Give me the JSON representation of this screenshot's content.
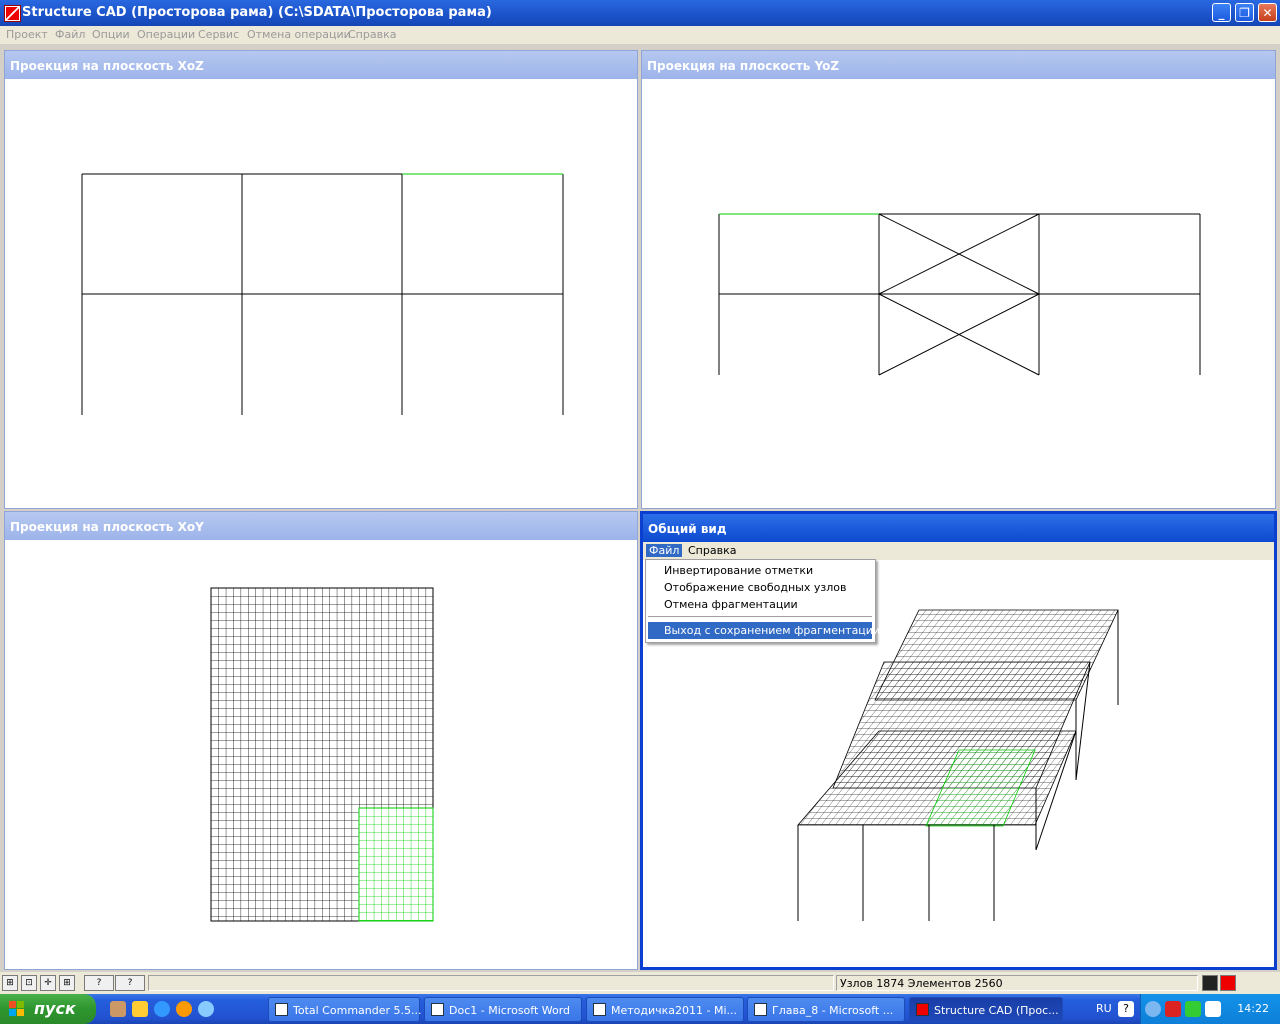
{
  "window": {
    "title": "Structure CAD (Просторова рама) (C:\\SDATA\\Просторова рама)",
    "controls": [
      "minimize",
      "restore",
      "close"
    ]
  },
  "menu": [
    "Проект",
    "Файл",
    "Опции",
    "Операции",
    "Сервис",
    "Отмена операции",
    "Справка"
  ],
  "panels": {
    "xoz": {
      "title": "Проекция на плоскость XoZ"
    },
    "yoz": {
      "title": "Проекция на плоскость YoZ"
    },
    "xoy": {
      "title": "Проекция на плоскость XoY"
    },
    "general": {
      "title": "Общий вид",
      "menu": [
        "Файл",
        "Справка"
      ],
      "open_menu": "Файл",
      "dropdown": [
        "Инвертирование отметки",
        "Отображение свободных узлов",
        "Отмена фрагментации",
        "Выход с сохранением фрагментации"
      ],
      "highlighted_item": "Выход с сохранением фрагментации"
    }
  },
  "colors": {
    "fragment": "#00cc00",
    "active_title": "#0d4ad0",
    "inactive_title": "#9db4ea"
  },
  "status": {
    "text": "Узлов 1874 Элементов 2560"
  },
  "taskbar": {
    "start": "пуск",
    "tasks": [
      "Total Commander 5.5...",
      "Doc1 - Microsoft Word",
      "Методичка2011 - Mi...",
      "Глава_8 - Microsoft ...",
      "Structure CAD (Прос..."
    ],
    "language": "RU",
    "clock": "14:22"
  }
}
